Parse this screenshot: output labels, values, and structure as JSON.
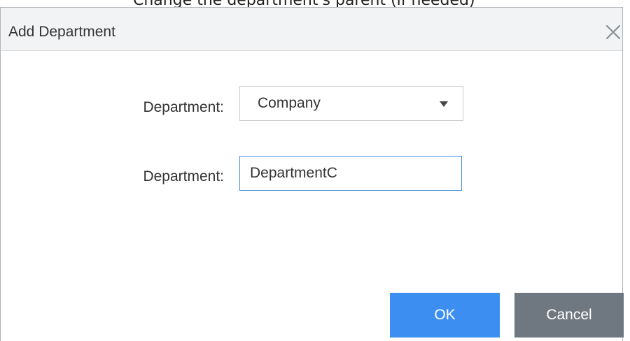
{
  "top_strip": {
    "text": "Change the department's parent (if needed)"
  },
  "dialog": {
    "title": "Add Department",
    "close_icon": "close-icon"
  },
  "form": {
    "parent_label": "Department:",
    "parent_value": "Company",
    "name_label": "Department:",
    "name_value": "DepartmentC"
  },
  "buttons": {
    "ok_label": "OK",
    "cancel_label": "Cancel"
  },
  "colors": {
    "ok_bg": "#3c8ff1",
    "cancel_bg": "#6f7780",
    "input_focus_border": "#4a90d9",
    "titlebar_bg": "#f2f3f4"
  }
}
